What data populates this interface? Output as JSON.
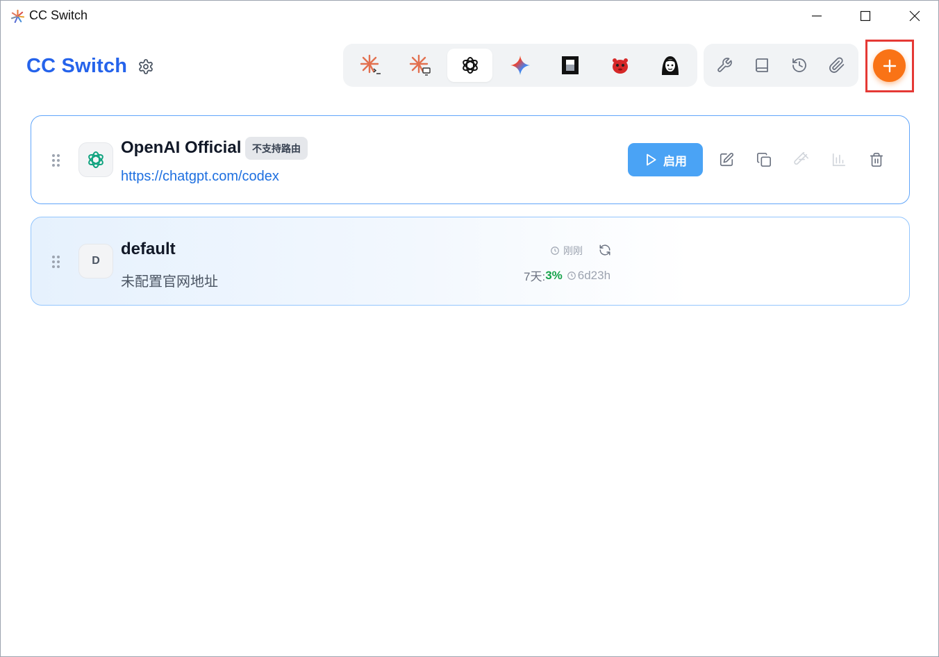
{
  "window": {
    "title": "CC Switch"
  },
  "header": {
    "brand": "CC Switch",
    "apps": [
      {
        "name": "claude-code",
        "icon": "claude-terminal-icon",
        "active": false
      },
      {
        "name": "claude-desktop",
        "icon": "claude-desktop-icon",
        "active": false
      },
      {
        "name": "codex",
        "icon": "openai-icon",
        "active": true
      },
      {
        "name": "gemini",
        "icon": "gemini-icon",
        "active": false
      },
      {
        "name": "opencode",
        "icon": "opencode-icon",
        "active": false
      },
      {
        "name": "red-mascot",
        "icon": "red-mascot-icon",
        "active": false
      },
      {
        "name": "avatar-app",
        "icon": "avatar-app-icon",
        "active": false
      }
    ],
    "tools": [
      "wrench-icon",
      "book-icon",
      "history-icon",
      "paperclip-icon"
    ],
    "add_button": "plus-icon"
  },
  "providers": [
    {
      "name": "OpenAI Official",
      "badge": "不支持路由",
      "url": "https://chatgpt.com/codex",
      "enable_label": "启用",
      "icon": "openai-icon"
    },
    {
      "name": "default",
      "letter": "D",
      "subtitle": "未配置官网地址",
      "usage": {
        "updated": "刚刚",
        "period": "7天:",
        "percent": "3%",
        "reset": "6d23h"
      }
    }
  ],
  "colors": {
    "brand": "#2563eb",
    "accent_orange": "#f97316",
    "enable_blue": "#4aa3f5",
    "highlight_red": "#e53935",
    "usage_green": "#16a34a"
  }
}
